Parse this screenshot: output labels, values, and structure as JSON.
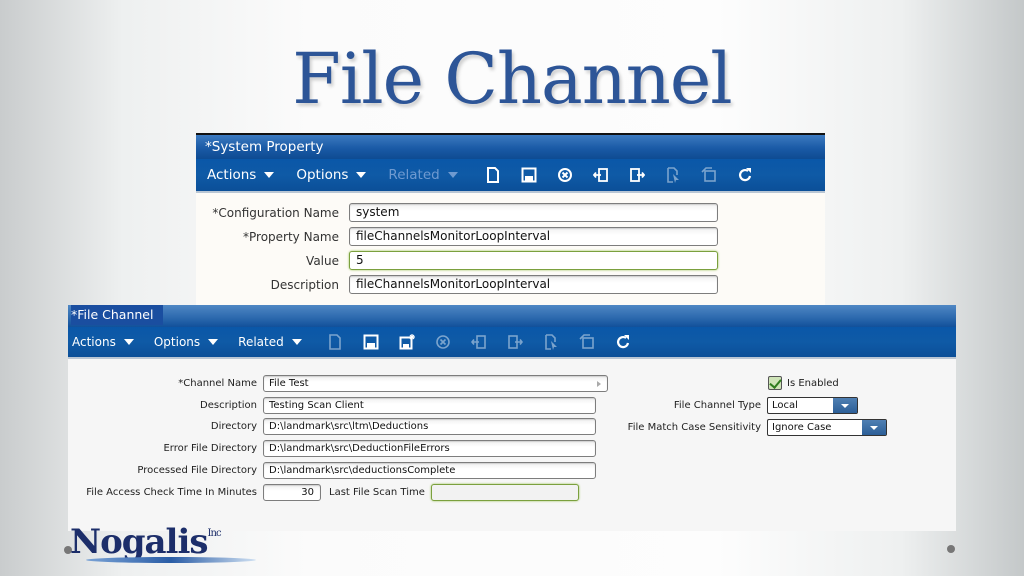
{
  "slide": {
    "title": "File Channel",
    "logo": {
      "name": "Nogalis",
      "suffix": "Inc"
    }
  },
  "system_property": {
    "title": "*System Property",
    "menus": [
      {
        "label": "Actions",
        "enabled": true
      },
      {
        "label": "Options",
        "enabled": true
      },
      {
        "label": "Related",
        "enabled": false
      }
    ],
    "tools": [
      {
        "icon": "new-document-icon",
        "enabled": true
      },
      {
        "icon": "save-icon",
        "enabled": true
      },
      {
        "icon": "delete-icon",
        "enabled": true
      },
      {
        "icon": "import-icon",
        "enabled": true
      },
      {
        "icon": "export-icon",
        "enabled": true
      },
      {
        "icon": "select-icon",
        "enabled": false
      },
      {
        "icon": "copy-icon",
        "enabled": false
      },
      {
        "icon": "refresh-icon",
        "enabled": true
      }
    ],
    "fields": [
      {
        "label": "*Configuration Name",
        "value": "system"
      },
      {
        "label": "*Property Name",
        "value": "fileChannelsMonitorLoopInterval"
      },
      {
        "label": "Value",
        "value": "5"
      },
      {
        "label": "Description",
        "value": "fileChannelsMonitorLoopInterval"
      }
    ]
  },
  "file_channel": {
    "title": "*File Channel",
    "menus": [
      {
        "label": "Actions",
        "enabled": true
      },
      {
        "label": "Options",
        "enabled": true
      },
      {
        "label": "Related",
        "enabled": true
      }
    ],
    "tools": [
      {
        "icon": "new-document-icon",
        "enabled": false
      },
      {
        "icon": "save-icon",
        "enabled": true
      },
      {
        "icon": "save-new-icon",
        "enabled": true
      },
      {
        "icon": "delete-icon",
        "enabled": false
      },
      {
        "icon": "import-icon",
        "enabled": false
      },
      {
        "icon": "export-icon",
        "enabled": false
      },
      {
        "icon": "select-icon",
        "enabled": false
      },
      {
        "icon": "copy-icon",
        "enabled": false
      },
      {
        "icon": "refresh-icon",
        "enabled": true
      }
    ],
    "fields": {
      "channel_name": {
        "label": "*Channel Name",
        "value": "File Test"
      },
      "description": {
        "label": "Description",
        "value": "Testing Scan Client"
      },
      "directory": {
        "label": "Directory",
        "value": "D:\\landmark\\src\\ltm\\Deductions"
      },
      "error_directory": {
        "label": "Error File Directory",
        "value": "D:\\landmark\\src\\DeductionFileErrors"
      },
      "processed_directory": {
        "label": "Processed File Directory",
        "value": "D:\\landmark\\src\\deductionsComplete"
      },
      "access_check": {
        "label": "File Access Check Time In Minutes",
        "value": "30"
      },
      "last_scan": {
        "label": "Last File Scan Time",
        "value": ""
      },
      "is_enabled": {
        "label": "Is Enabled",
        "checked": true
      },
      "channel_type": {
        "label": "File Channel Type",
        "value": "Local"
      },
      "case_sensitivity": {
        "label": "File Match Case Sensitivity",
        "value": "Ignore Case"
      }
    }
  }
}
